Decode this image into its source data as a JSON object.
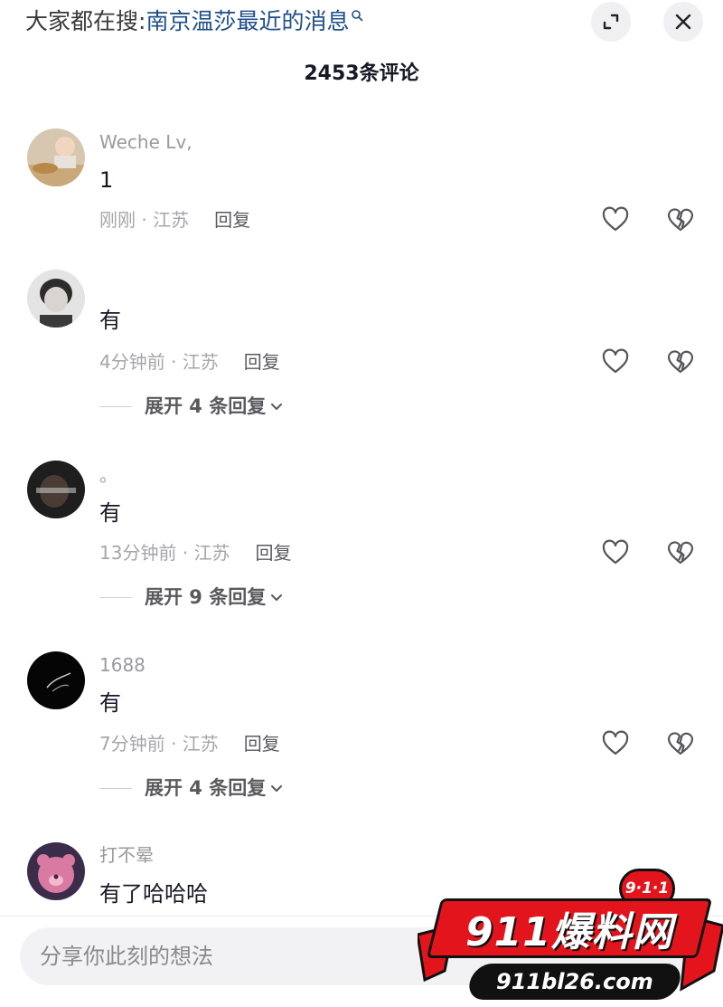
{
  "header": {
    "search_prefix": "大家都在搜:",
    "search_query": "南京温莎最近的消息",
    "comment_count": "2453条评论"
  },
  "comments": [
    {
      "username": "Weche Lv,",
      "text": "1",
      "time_location": "刚刚 · 江苏",
      "reply_label": "回复",
      "expand_label": ""
    },
    {
      "username": "",
      "text": "有",
      "time_location": "4分钟前 · 江苏",
      "reply_label": "回复",
      "expand_label": "展开 4 条回复"
    },
    {
      "username": "。",
      "text": "有",
      "time_location": "13分钟前 · 江苏",
      "reply_label": "回复",
      "expand_label": "展开 9 条回复"
    },
    {
      "username": "1688",
      "text": "有",
      "time_location": "7分钟前 · 江苏",
      "reply_label": "回复",
      "expand_label": "展开 4 条回复"
    },
    {
      "username": "打不晕",
      "text": "有了哈哈哈",
      "time_location": "",
      "reply_label": "",
      "expand_label": ""
    }
  ],
  "input": {
    "placeholder": "分享你此刻的想法"
  },
  "watermark": {
    "badge": "9·1·1",
    "main": "911爆料网",
    "url": "911bl26.com"
  },
  "icons": {
    "search_query": "magnifier-icon",
    "expand": "expand-corner-icon",
    "close": "close-icon",
    "like": "heart-outline-icon",
    "dislike": "broken-heart-icon",
    "expand_replies": "chevron-down-icon"
  },
  "colors": {
    "link": "#1f4e8c",
    "muted": "#a6a6aa",
    "watermark_red": "#e4141c"
  }
}
